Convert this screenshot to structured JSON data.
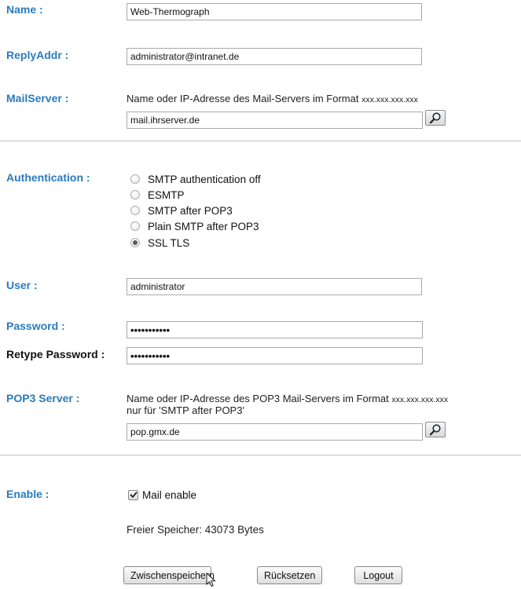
{
  "name": {
    "label": "Name :",
    "value": "Web-Thermograph"
  },
  "replyaddr": {
    "label": "ReplyAddr :",
    "value": "administrator@intranet.de"
  },
  "mailserver": {
    "label": "MailServer :",
    "hint": "Name oder IP-Adresse des Mail-Servers im Format",
    "hint_format": "xxx.xxx.xxx.xxx",
    "value": "mail.ihrserver.de",
    "search_icon": "magnifier-icon"
  },
  "authentication": {
    "label": "Authentication :",
    "options": [
      {
        "label": "SMTP authentication off",
        "selected": false
      },
      {
        "label": "ESMTP",
        "selected": false
      },
      {
        "label": "SMTP after POP3",
        "selected": false
      },
      {
        "label": "Plain SMTP after POP3",
        "selected": false
      },
      {
        "label": "SSL TLS",
        "selected": true
      }
    ]
  },
  "user": {
    "label": "User :",
    "value": "administrator"
  },
  "password": {
    "label": "Password :",
    "value": "•••••••••••"
  },
  "retype_password": {
    "label": "Retype Password :",
    "value": "•••••••••••"
  },
  "pop3server": {
    "label": "POP3 Server :",
    "hint": "Name oder IP-Adresse des POP3 Mail-Servers im Format",
    "hint_format": "xxx.xxx.xxx.xxx",
    "hint2": "nur für 'SMTP after POP3'",
    "value": "pop.gmx.de",
    "search_icon": "magnifier-icon"
  },
  "enable": {
    "label": "Enable :",
    "checkbox_label": "Mail enable",
    "checked": true
  },
  "free_memory": "Freier Speicher: 43073 Bytes",
  "buttons": {
    "save": "Zwischenspeichern",
    "reset": "Rücksetzen",
    "logout": "Logout"
  },
  "colors": {
    "label_blue": "#2b7bbd",
    "divider": "#bdbdbd"
  }
}
